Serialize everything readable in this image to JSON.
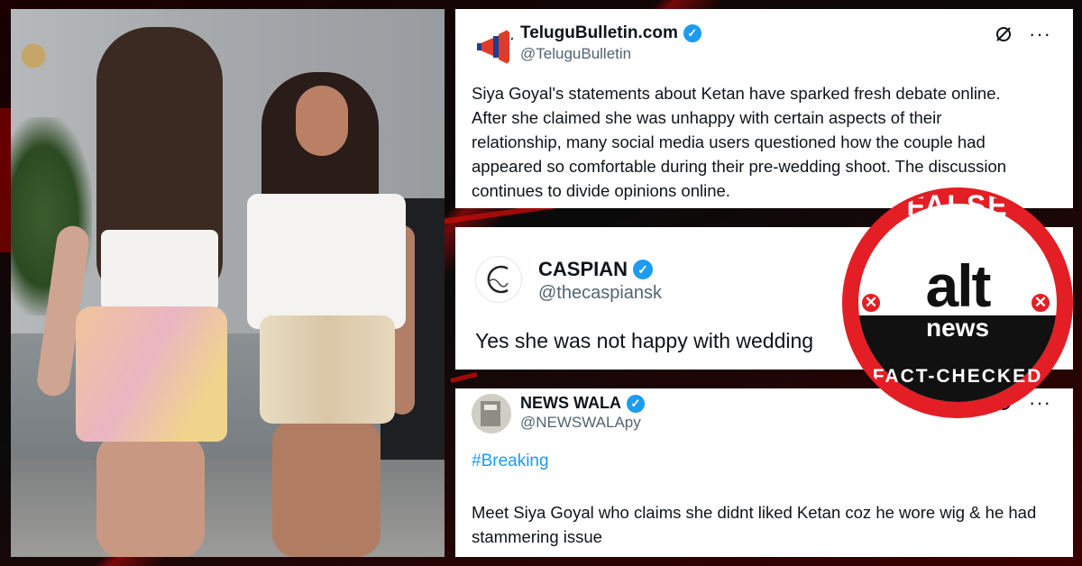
{
  "tweets": [
    {
      "name": "TeluguBulletin.com",
      "handle": "@TeluguBulletin",
      "verified": true,
      "avatar_icon": "megaphone-icon",
      "text": "Siya Goyal's statements about Ketan have sparked fresh debate online. After she claimed she was unhappy with certain aspects of their relationship, many social media users questioned how the couple had appeared so comfortable during their pre-wedding shoot. The discussion continues to divide opinions online."
    },
    {
      "name": "CASPIAN",
      "handle": "@thecaspiansk",
      "verified": true,
      "avatar_icon": "caspian-logo-icon",
      "text": "Yes she was not happy with wedding"
    },
    {
      "name": "NEWS WALA",
      "handle": "@NEWSWALApy",
      "verified": true,
      "avatar_icon": "newswala-avatar-icon",
      "hashtag": "#Breaking",
      "text": "Meet Siya Goyal who claims she didnt liked Ketan coz he wore wig & he had stammering issue"
    }
  ],
  "stamp": {
    "top_text": "FALSE",
    "logo_top": "alt",
    "logo_bottom": "news",
    "bottom_text": "FACT-CHECKED",
    "color": "#e31e24"
  },
  "colors": {
    "accent": "#1d9bf0",
    "stamp_red": "#e31e24",
    "background": "#0d0d0d"
  }
}
